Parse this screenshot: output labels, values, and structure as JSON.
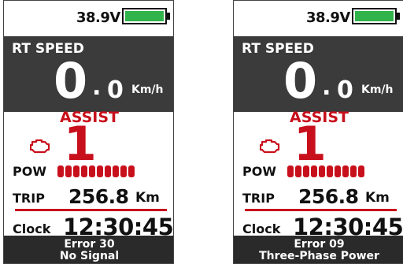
{
  "screens": [
    {
      "voltage": "38.9V",
      "battery_level": 1.0,
      "speed_title": "RT SPEED",
      "speed_int": "0",
      "speed_dot": ".",
      "speed_dec": "0",
      "speed_unit": "Km/h",
      "assist_label": "ASSIST",
      "assist_level": "1",
      "pow_label": "POW",
      "pow_segments": 10,
      "trip_label": "TRIP",
      "trip_value": "256.8",
      "trip_unit": "Km",
      "clock_label": "Clock",
      "clock_value": "12:30:45",
      "error_code": "Error 30",
      "error_msg": "No Signal"
    },
    {
      "voltage": "38.9V",
      "battery_level": 1.0,
      "speed_title": "RT SPEED",
      "speed_int": "0",
      "speed_dot": ".",
      "speed_dec": "0",
      "speed_unit": "Km/h",
      "assist_label": "ASSIST",
      "assist_level": "1",
      "pow_label": "POW",
      "pow_segments": 10,
      "trip_label": "TRIP",
      "trip_value": "256.8",
      "trip_unit": "Km",
      "clock_label": "Clock",
      "clock_value": "12:30:45",
      "error_code": "Error 09",
      "error_msg": "Three-Phase Power"
    }
  ],
  "colors": {
    "accent_red": "#c8101c",
    "battery_green": "#2fb34a",
    "panel_dark": "#3b3b3b",
    "error_bar": "#2a2a2a"
  },
  "icons": {
    "engine": "engine-warning-icon",
    "battery": "battery-icon"
  }
}
